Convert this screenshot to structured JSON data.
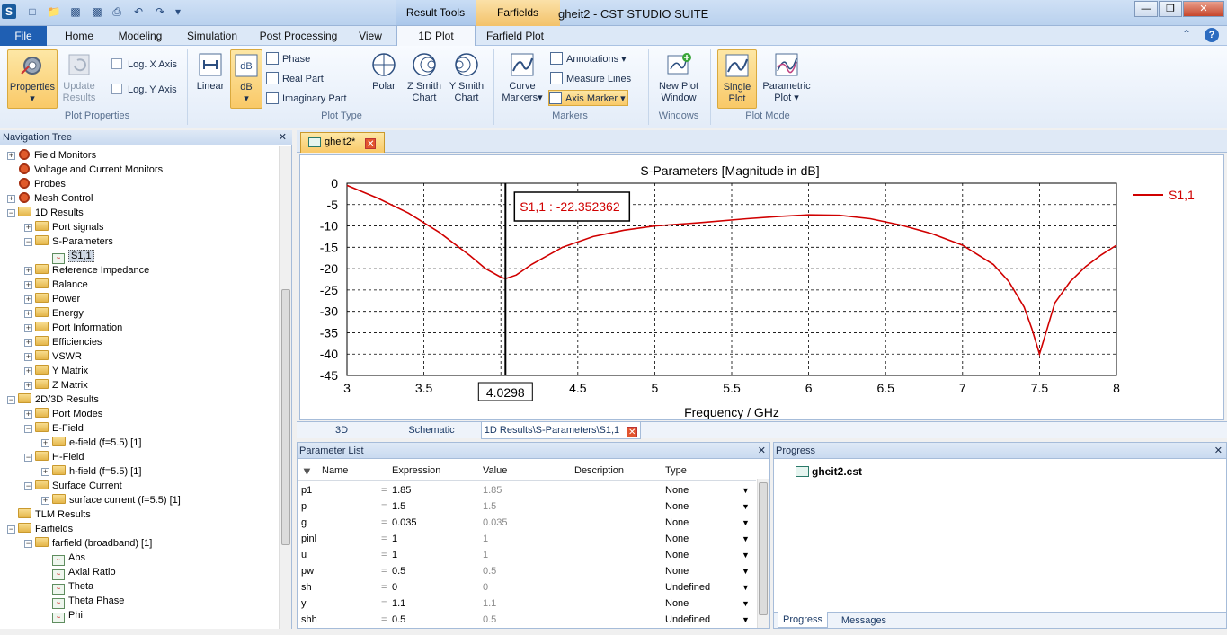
{
  "window": {
    "title": "gheit2 - CST STUDIO SUITE",
    "context_tabs": [
      "Result Tools",
      "Farfields"
    ]
  },
  "menu": {
    "file": "File",
    "tabs": [
      "Home",
      "Modeling",
      "Simulation",
      "Post Processing",
      "View",
      "1D Plot",
      "Farfield Plot"
    ],
    "active_tab": "1D Plot"
  },
  "ribbon": {
    "properties": "Properties",
    "update_results_1": "Update",
    "update_results_2": "Results",
    "log_x": "Log. X Axis",
    "log_y": "Log. Y Axis",
    "group_plot_properties": "Plot Properties",
    "linear": "Linear",
    "db": "dB",
    "phase": "Phase",
    "real_part": "Real Part",
    "imaginary_part": "Imaginary Part",
    "polar": "Polar",
    "z_smith_1": "Z Smith",
    "z_smith_2": "Chart",
    "y_smith_1": "Y Smith",
    "y_smith_2": "Chart",
    "group_plot_type": "Plot Type",
    "curve_markers_1": "Curve",
    "curve_markers_2": "Markers",
    "annotations": "Annotations",
    "measure_lines": "Measure Lines",
    "axis_marker": "Axis Marker",
    "group_markers": "Markers",
    "new_plot_window_1": "New Plot",
    "new_plot_window_2": "Window",
    "group_windows": "Windows",
    "single_plot_1": "Single",
    "single_plot_2": "Plot",
    "parametric_plot_1": "Parametric",
    "parametric_plot_2": "Plot",
    "group_plot_mode": "Plot Mode"
  },
  "nav_tree": {
    "header": "Navigation Tree",
    "items": [
      {
        "label": "Field Monitors",
        "level": 0,
        "exp": "+",
        "icon": "gear"
      },
      {
        "label": "Voltage and Current Monitors",
        "level": 0,
        "exp": "",
        "icon": "gear"
      },
      {
        "label": "Probes",
        "level": 0,
        "exp": "",
        "icon": "gear"
      },
      {
        "label": "Mesh Control",
        "level": 0,
        "exp": "+",
        "icon": "gear"
      },
      {
        "label": "1D Results",
        "level": 0,
        "exp": "-",
        "icon": "folder"
      },
      {
        "label": "Port signals",
        "level": 1,
        "exp": "+",
        "icon": "folder"
      },
      {
        "label": "S-Parameters",
        "level": 1,
        "exp": "-",
        "icon": "folder"
      },
      {
        "label": "S1,1",
        "level": 2,
        "exp": "",
        "icon": "leaf",
        "selected": true
      },
      {
        "label": "Reference Impedance",
        "level": 1,
        "exp": "+",
        "icon": "folder"
      },
      {
        "label": "Balance",
        "level": 1,
        "exp": "+",
        "icon": "folder"
      },
      {
        "label": "Power",
        "level": 1,
        "exp": "+",
        "icon": "folder"
      },
      {
        "label": "Energy",
        "level": 1,
        "exp": "+",
        "icon": "folder"
      },
      {
        "label": "Port Information",
        "level": 1,
        "exp": "+",
        "icon": "folder"
      },
      {
        "label": "Efficiencies",
        "level": 1,
        "exp": "+",
        "icon": "folder"
      },
      {
        "label": "VSWR",
        "level": 1,
        "exp": "+",
        "icon": "folder"
      },
      {
        "label": "Y Matrix",
        "level": 1,
        "exp": "+",
        "icon": "folder"
      },
      {
        "label": "Z Matrix",
        "level": 1,
        "exp": "+",
        "icon": "folder"
      },
      {
        "label": "2D/3D Results",
        "level": 0,
        "exp": "-",
        "icon": "folder"
      },
      {
        "label": "Port Modes",
        "level": 1,
        "exp": "+",
        "icon": "folder"
      },
      {
        "label": "E-Field",
        "level": 1,
        "exp": "-",
        "icon": "folder"
      },
      {
        "label": "e-field (f=5.5) [1]",
        "level": 2,
        "exp": "+",
        "icon": "folder"
      },
      {
        "label": "H-Field",
        "level": 1,
        "exp": "-",
        "icon": "folder"
      },
      {
        "label": "h-field (f=5.5) [1]",
        "level": 2,
        "exp": "+",
        "icon": "folder"
      },
      {
        "label": "Surface Current",
        "level": 1,
        "exp": "-",
        "icon": "folder"
      },
      {
        "label": "surface current (f=5.5) [1]",
        "level": 2,
        "exp": "+",
        "icon": "folder"
      },
      {
        "label": "TLM Results",
        "level": 0,
        "exp": "",
        "icon": "folder"
      },
      {
        "label": "Farfields",
        "level": 0,
        "exp": "-",
        "icon": "folder"
      },
      {
        "label": "farfield (broadband) [1]",
        "level": 1,
        "exp": "-",
        "icon": "folder"
      },
      {
        "label": "Abs",
        "level": 2,
        "exp": "",
        "icon": "leaf"
      },
      {
        "label": "Axial Ratio",
        "level": 2,
        "exp": "",
        "icon": "leaf"
      },
      {
        "label": "Theta",
        "level": 2,
        "exp": "",
        "icon": "leaf"
      },
      {
        "label": "Theta Phase",
        "level": 2,
        "exp": "",
        "icon": "leaf"
      },
      {
        "label": "Phi",
        "level": 2,
        "exp": "",
        "icon": "leaf"
      }
    ]
  },
  "document_tab": "gheit2*",
  "bottom_tabs": [
    "3D",
    "Schematic",
    "1D Results\\S-Parameters\\S1,1"
  ],
  "chart_data": {
    "type": "line",
    "title": "S-Parameters [Magnitude in dB]",
    "xlabel": "Frequency / GHz",
    "ylabel": "",
    "xlim": [
      3,
      8
    ],
    "ylim": [
      -45,
      0
    ],
    "xticks": [
      "3",
      "3.5",
      "4",
      "4.5",
      "5",
      "5.5",
      "6",
      "6.5",
      "7",
      "7.5",
      "8"
    ],
    "yticks": [
      "0",
      "-5",
      "-10",
      "-15",
      "-20",
      "-25",
      "-30",
      "-35",
      "-40",
      "-45"
    ],
    "grid": true,
    "legend": "top-right",
    "line_color": "#d00000",
    "series": [
      {
        "name": "S1,1",
        "x": [
          3.0,
          3.2,
          3.4,
          3.6,
          3.8,
          3.9,
          4.0,
          4.03,
          4.1,
          4.2,
          4.4,
          4.6,
          4.8,
          5.0,
          5.3,
          5.6,
          5.8,
          6.0,
          6.2,
          6.4,
          6.6,
          6.8,
          7.0,
          7.2,
          7.3,
          7.4,
          7.45,
          7.5,
          7.55,
          7.6,
          7.7,
          7.8,
          7.9,
          8.0
        ],
        "y": [
          -0.5,
          -3.5,
          -7,
          -11.5,
          -17,
          -20,
          -22,
          -22.35,
          -21.5,
          -19,
          -15,
          -12.5,
          -11,
          -10,
          -9.2,
          -8.3,
          -7.8,
          -7.4,
          -7.5,
          -8.3,
          -9.8,
          -11.8,
          -14.5,
          -19,
          -23,
          -29,
          -34,
          -40,
          -34,
          -28,
          -23,
          -19.5,
          -16.8,
          -14.5
        ]
      }
    ],
    "marker": {
      "x": 4.0298,
      "x_label": "4.0298",
      "label": "S1,1 : -22.352362"
    }
  },
  "parameter_list": {
    "header": "Parameter List",
    "columns": [
      "Name",
      "Expression",
      "Value",
      "Description",
      "Type"
    ],
    "rows": [
      {
        "name": "p1",
        "expr": "1.85",
        "value": "1.85",
        "type": "None"
      },
      {
        "name": "p",
        "expr": "1.5",
        "value": "1.5",
        "type": "None"
      },
      {
        "name": "g",
        "expr": "0.035",
        "value": "0.035",
        "type": "None"
      },
      {
        "name": "pinl",
        "expr": "1",
        "value": "1",
        "type": "None"
      },
      {
        "name": "u",
        "expr": "1",
        "value": "1",
        "type": "None"
      },
      {
        "name": "pw",
        "expr": "0.5",
        "value": "0.5",
        "type": "None"
      },
      {
        "name": "sh",
        "expr": "0",
        "value": "0",
        "type": "Undefined"
      },
      {
        "name": "y",
        "expr": "1.1",
        "value": "1.1",
        "type": "None"
      },
      {
        "name": "shh",
        "expr": "0.5",
        "value": "0.5",
        "type": "Undefined"
      }
    ]
  },
  "progress": {
    "header": "Progress",
    "file": "gheit2.cst",
    "tabs": [
      "Progress",
      "Messages"
    ]
  }
}
